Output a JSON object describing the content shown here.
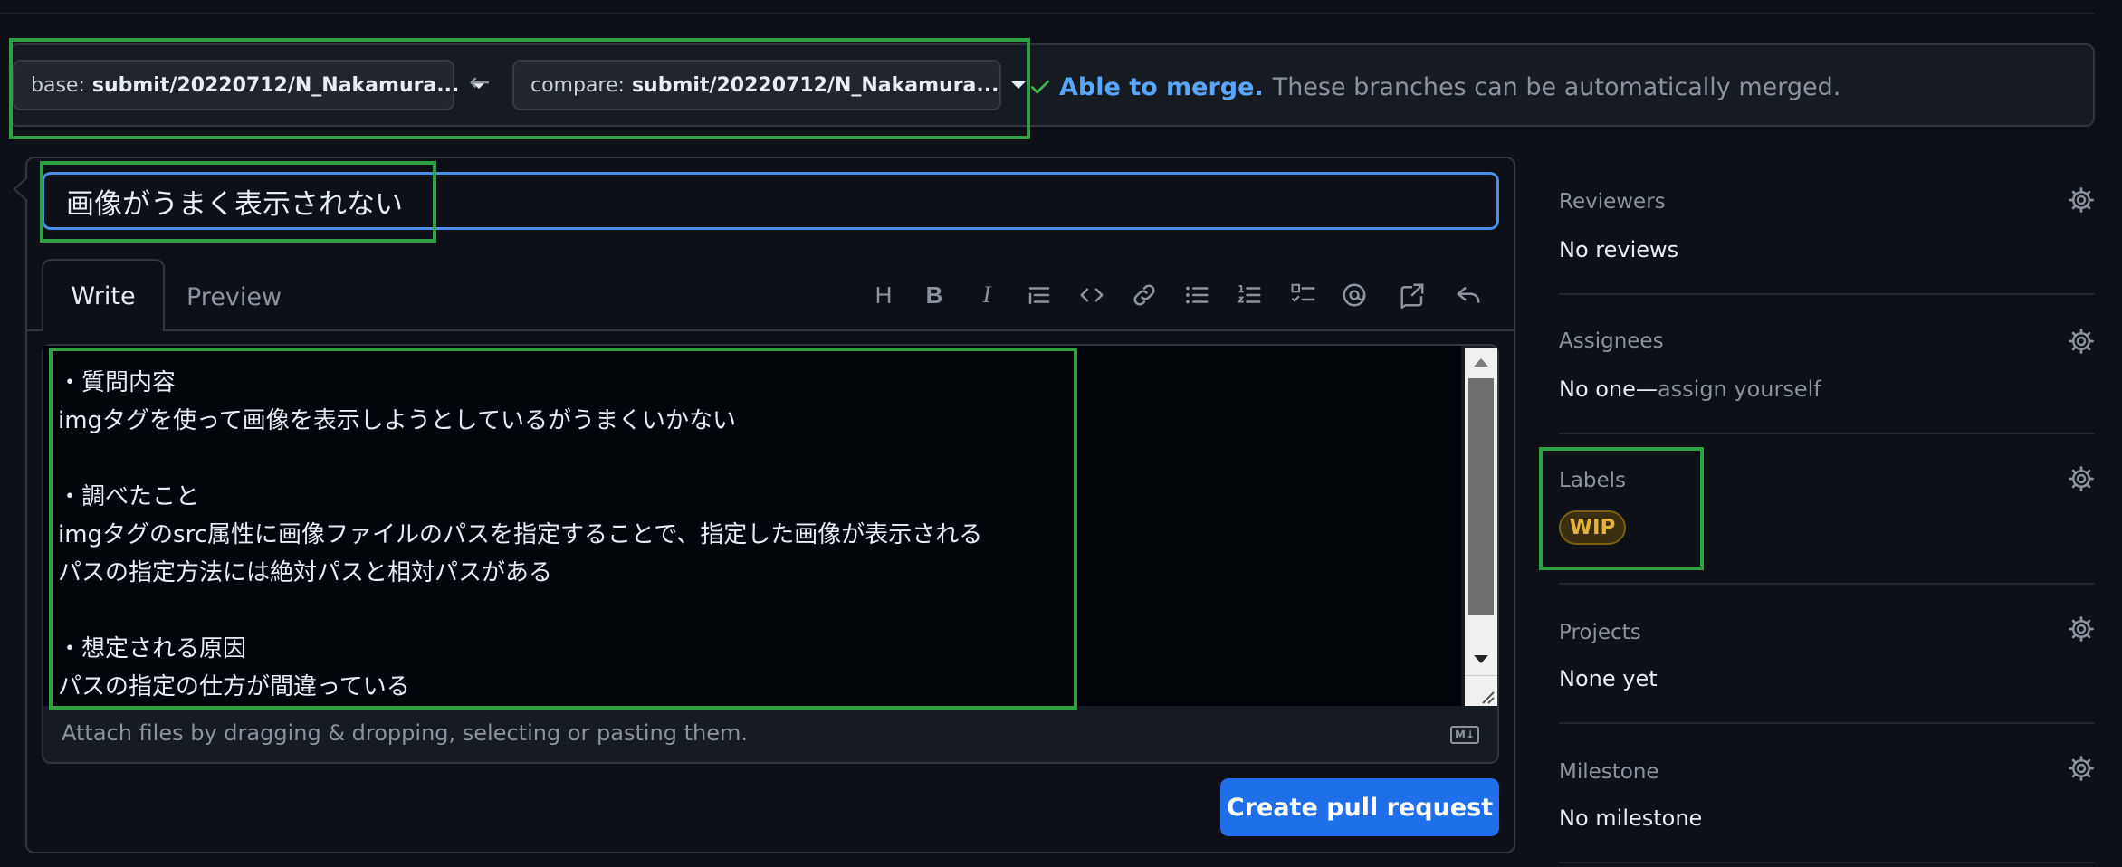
{
  "compare": {
    "base_key": "base:",
    "base_value": "submit/20220712/N_Nakamura...",
    "arrow": "←",
    "compare_key": "compare:",
    "compare_value": "submit/20220712/N_Nakamura...",
    "merge_ok": "Able to merge.",
    "merge_rest": "These branches can be automatically merged."
  },
  "form": {
    "title": "画像がうまく表示されない",
    "tab_write": "Write",
    "tab_preview": "Preview",
    "body": "・質問内容\nimgタグを使って画像を表示しようとしているがうまくいかない\n\n・調べたこと\nimgタグのsrc属性に画像ファイルのパスを指定することで、指定した画像が表示される\nパスの指定方法には絶対パスと相対パスがある\n\n・想定される原因\nパスの指定の仕方が間違っている",
    "attach_hint": "Attach files by dragging & dropping, selecting or pasting them.",
    "markdown_badge": "M↓",
    "submit_label": "Create pull request"
  },
  "toolbar": {
    "heading": "H",
    "bold": "B",
    "italic": "I"
  },
  "sidebar": {
    "reviewers": {
      "label": "Reviewers",
      "value": "No reviews"
    },
    "assignees": {
      "label": "Assignees",
      "value": "No one—",
      "link": "assign yourself"
    },
    "labels": {
      "label": "Labels",
      "badge": "WIP"
    },
    "projects": {
      "label": "Projects",
      "value": "None yet"
    },
    "milestone": {
      "label": "Milestone",
      "value": "No milestone"
    }
  },
  "colors": {
    "background": "#0d1117",
    "accent": "#58a6ff",
    "primary_button": "#1f6feb",
    "highlight": "#2ea043",
    "wip": "#e3b341"
  }
}
